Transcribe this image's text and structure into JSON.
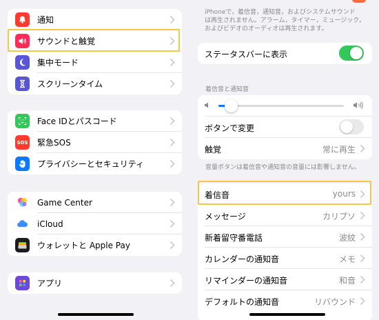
{
  "colors": {
    "highlight": "#f5c842",
    "toggle_on": "#34c759",
    "slider_accent": "#0a7aff"
  },
  "left": {
    "group1": [
      {
        "label": "通知",
        "icon": "bell-icon",
        "color": "#ff3b30"
      },
      {
        "label": "サウンドと触覚",
        "icon": "speaker-icon",
        "color": "#ff2d55"
      },
      {
        "label": "集中モード",
        "icon": "moon-icon",
        "color": "#5856d6"
      },
      {
        "label": "スクリーンタイム",
        "icon": "hourglass-icon",
        "color": "#5856d6"
      }
    ],
    "group2": [
      {
        "label": "Face IDとパスコード",
        "icon": "faceid-icon",
        "color": "#34c759"
      },
      {
        "label": "緊急SOS",
        "icon": "sos-icon",
        "color": "#ff3b30",
        "badge": "SOS"
      },
      {
        "label": "プライバシーとセキュリティ",
        "icon": "hand-icon",
        "color": "#0a7aff"
      }
    ],
    "group3": [
      {
        "label": "Game Center",
        "icon": "game-center-icon",
        "color": "#ffffff"
      },
      {
        "label": "iCloud",
        "icon": "cloud-icon",
        "color": "#ffffff"
      },
      {
        "label": "ウォレットと Apple Pay",
        "icon": "wallet-icon",
        "color": "#1c1c1e"
      }
    ],
    "group4": [
      {
        "label": "アプリ",
        "icon": "apps-icon",
        "color": "#6e48d8"
      }
    ]
  },
  "right": {
    "top_footnote_lines": [
      "iPhoneで，着信音，通知音，およびシステムサウンド",
      "は再生されません。アラーム，タイマー，ミュージック，",
      "およびビデオのオーディオは再生されます。"
    ],
    "status_bar_label": "ステータスバーに表示",
    "ringtone_header": "着信音と通知音",
    "volume_slider_level": 0.1,
    "change_with_buttons_label": "ボタンで変更",
    "haptics_label": "触覚",
    "haptics_value": "常に再生",
    "volume_footnote": "音量ボタンは着信音や通知音の音量には影響しません。",
    "sounds": [
      {
        "label": "着信音",
        "value": "yours"
      },
      {
        "label": "メッセージ",
        "value": "カリプソ"
      },
      {
        "label": "新着留守番電話",
        "value": "波紋"
      },
      {
        "label": "カレンダーの通知音",
        "value": "メモ"
      },
      {
        "label": "リマインダーの通知音",
        "value": "和音"
      },
      {
        "label": "デフォルトの通知音",
        "value": "リバウンド"
      }
    ]
  }
}
